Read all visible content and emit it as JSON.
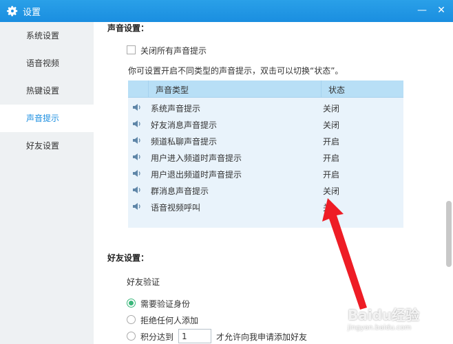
{
  "window": {
    "title": "设置",
    "minimize_glyph": "—",
    "close_glyph": "✕"
  },
  "sidebar": {
    "items": [
      {
        "label": "系统设置"
      },
      {
        "label": "语音视频"
      },
      {
        "label": "热键设置"
      },
      {
        "label": "声音提示",
        "active": true
      },
      {
        "label": "好友设置"
      }
    ]
  },
  "sound": {
    "section_title": "声音设置：",
    "mute_all_label": "关闭所有声音提示",
    "mute_all_checked": false,
    "hint": "你可设置开启不同类型的声音提示，双击可以切换“状态”。",
    "table": {
      "col_type": "声音类型",
      "col_state": "状态",
      "rows": [
        {
          "name": "系统声音提示",
          "state": "关闭"
        },
        {
          "name": "好友消息声音提示",
          "state": "关闭"
        },
        {
          "name": "频道私聊声音提示",
          "state": "开启"
        },
        {
          "name": "用户进入频道时声音提示",
          "state": "开启"
        },
        {
          "name": "用户退出频道时声音提示",
          "state": "开启"
        },
        {
          "name": "群消息声音提示",
          "state": "关闭"
        },
        {
          "name": "语音视频呼叫",
          "state": "关"
        }
      ]
    }
  },
  "friends": {
    "section_title": "好友设置：",
    "verify_label": "好友验证",
    "options": [
      {
        "label": "需要验证身份",
        "checked": true
      },
      {
        "label": "拒绝任何人添加",
        "checked": false
      },
      {
        "label": "积分达到",
        "checked": false
      }
    ],
    "points_value": "1",
    "points_suffix": "才允许向我申请添加好友"
  },
  "watermark": {
    "main": "Baidu经验",
    "sub": "jingyan.baidu.com"
  },
  "colors": {
    "titlebar": "#1a8ee0",
    "active_item": "#1a8ee0",
    "table_header": "#b8dff6",
    "table_body": "#e9f3fb",
    "radio_checked": "#3ab77a",
    "annotation_arrow": "#ee1c25"
  }
}
